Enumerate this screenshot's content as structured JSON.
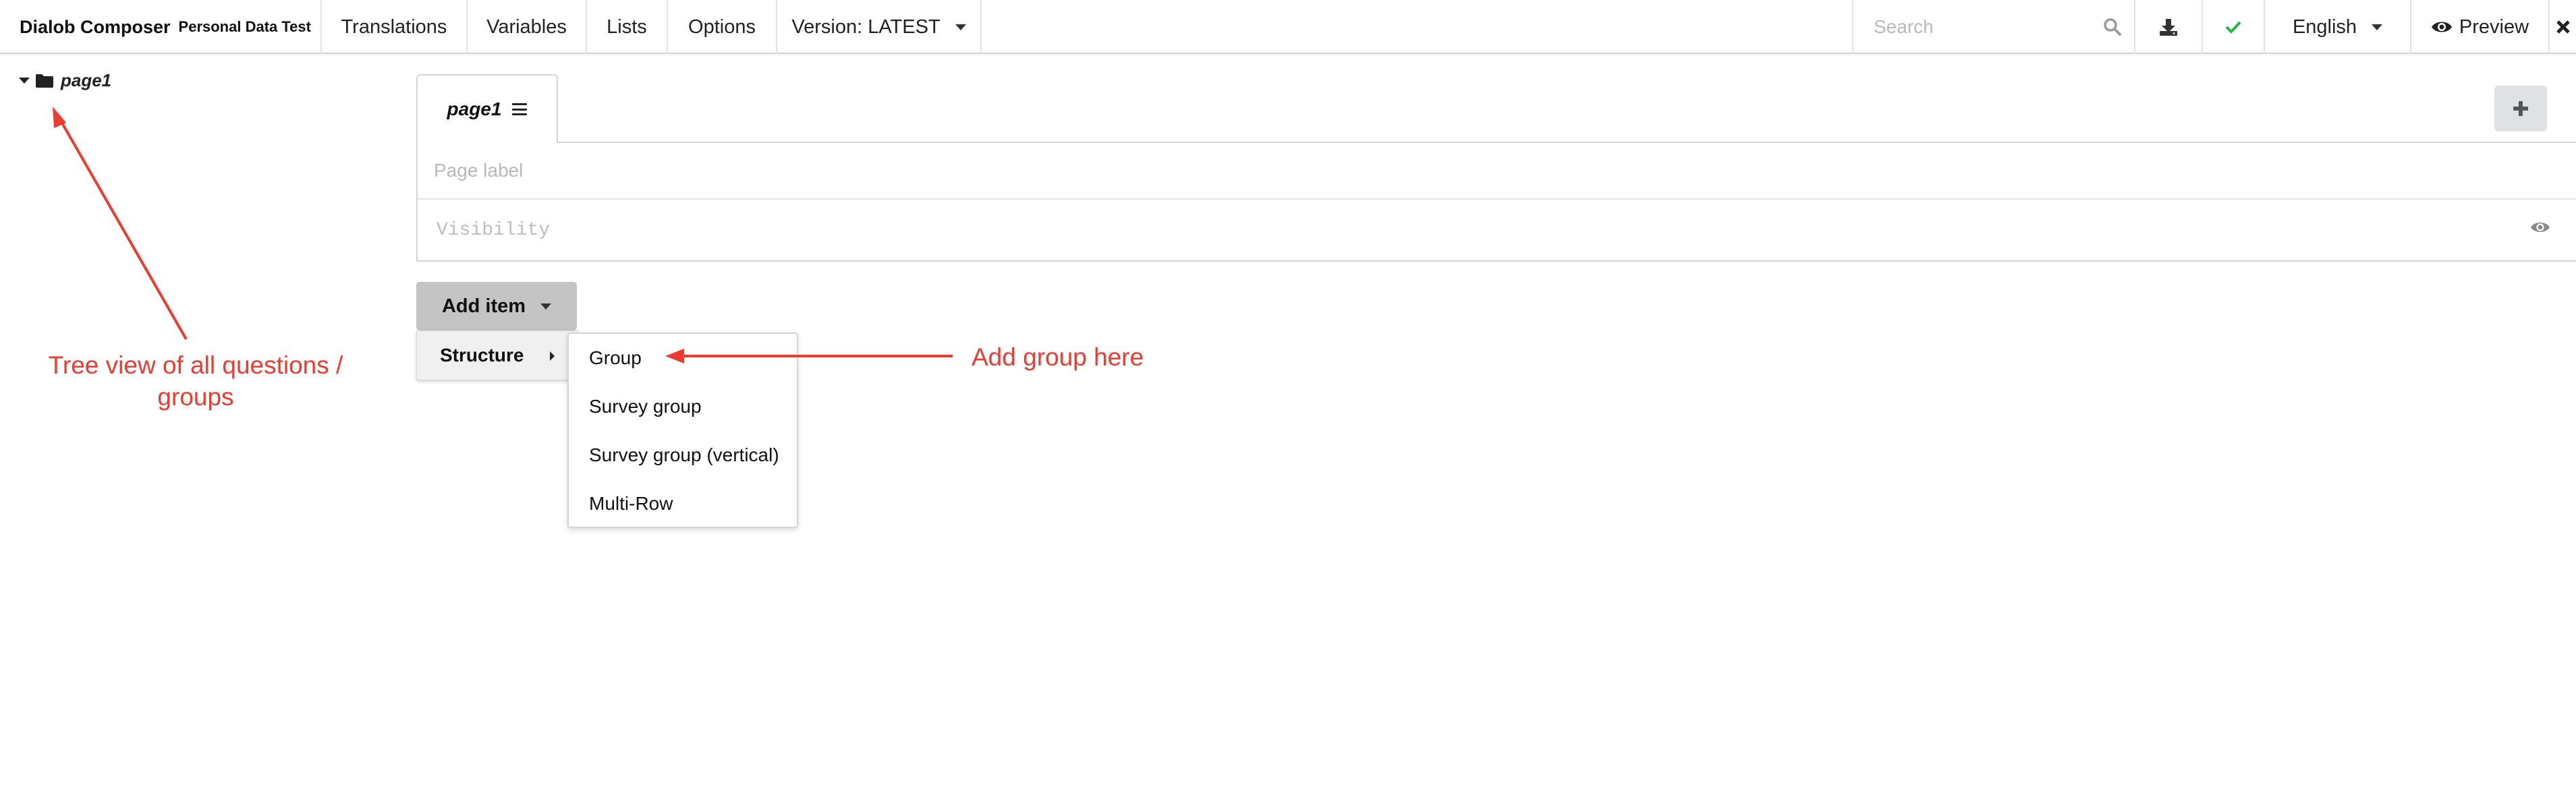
{
  "header": {
    "app_title": "Dialob Composer",
    "form_name": "Personal Data Test",
    "menu": {
      "translations": "Translations",
      "variables": "Variables",
      "lists": "Lists",
      "options": "Options",
      "version": "Version: LATEST"
    },
    "search_placeholder": "Search",
    "language": "English",
    "preview": "Preview"
  },
  "tree": {
    "root_label": "page1"
  },
  "page": {
    "tab_label": "page1",
    "page_label_placeholder": "Page label",
    "visibility_placeholder": "Visibility"
  },
  "add_item": {
    "label": "Add item",
    "category": "Structure",
    "options": [
      "Group",
      "Survey group",
      "Survey group (vertical)",
      "Multi-Row"
    ]
  },
  "annotations": {
    "tree_note": "Tree view of all questions / groups",
    "group_note": "Add group here",
    "color": "#ee3b30"
  },
  "colors": {
    "check": "#21ba45",
    "button_gray": "#c4c4c4"
  }
}
